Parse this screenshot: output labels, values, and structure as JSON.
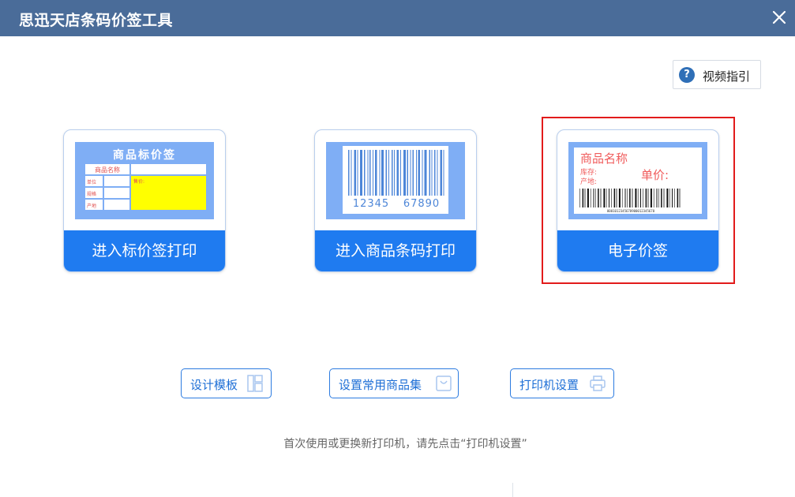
{
  "window": {
    "title": "思迅天店条码价签工具"
  },
  "video_guide": {
    "label": "视频指引"
  },
  "cards": [
    {
      "action_label": "进入标价签打印",
      "preview": {
        "title": "商品标价签",
        "rows": [
          "商品名称",
          "单位",
          "规格",
          "产地"
        ],
        "price_label": "售价:"
      }
    },
    {
      "action_label": "进入商品条码打印",
      "preview": {
        "barcode_text_left": "12345",
        "barcode_text_right": "67890"
      }
    },
    {
      "action_label": "电子价签",
      "preview": {
        "name": "商品名称",
        "stock": "库存:",
        "origin": "产地:",
        "price_label": "单价:",
        "barcode_digits": "0001012345678900012345678"
      }
    }
  ],
  "tools": {
    "design_template": "设计模板",
    "common_goods": "设置常用商品集",
    "printer_settings": "打印机设置"
  },
  "hint_text": "首次使用或更换新打印机，请先点击“打印机设置”",
  "colors": {
    "titlebar": "#4a6c99",
    "action_blue": "#1f7bf0",
    "highlight_red": "#e21b1b",
    "preview_bg": "#7faef5"
  }
}
